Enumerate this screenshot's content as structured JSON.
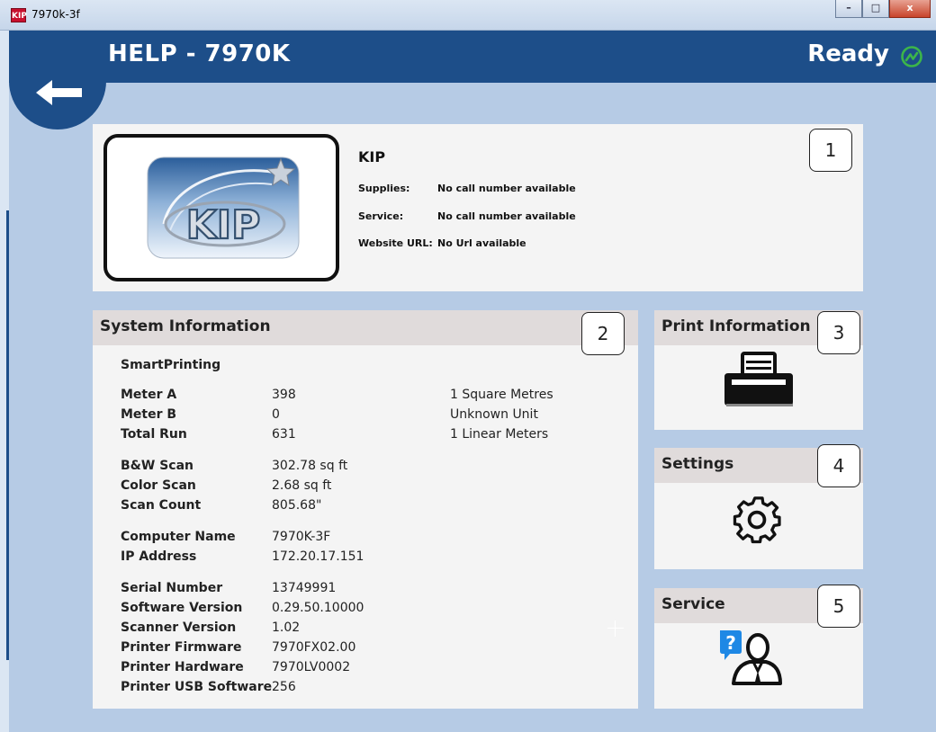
{
  "window": {
    "icon_text": "KIP",
    "title": "7970k-3f",
    "minimize": "–",
    "maximize": "□",
    "close": "x"
  },
  "header": {
    "title": "HELP - 7970K",
    "status": "Ready"
  },
  "contact": {
    "badge": "1",
    "brand": "KIP",
    "rows": [
      {
        "label": "Supplies:",
        "value": "No call number available"
      },
      {
        "label": "Service:",
        "value": "No call number available"
      },
      {
        "label": "Website URL:",
        "value": "No Url available"
      }
    ]
  },
  "system_info": {
    "title": "System Information",
    "badge": "2",
    "product": "SmartPrinting",
    "meters": [
      {
        "key": "Meter A",
        "value": "398",
        "unit": "1 Square Metres"
      },
      {
        "key": "Meter B",
        "value": "0",
        "unit": "Unknown Unit"
      },
      {
        "key": "Total Run",
        "value": "631",
        "unit": "1 Linear Meters"
      }
    ],
    "scan": [
      {
        "key": "B&W Scan",
        "value": "302.78 sq ft"
      },
      {
        "key": "Color Scan",
        "value": "2.68 sq ft"
      },
      {
        "key": "Scan Count",
        "value": "805.68\""
      }
    ],
    "network": [
      {
        "key": "Computer Name",
        "value": "7970K-3F"
      },
      {
        "key": "IP Address",
        "value": "172.20.17.151"
      }
    ],
    "versions": [
      {
        "key": "Serial Number",
        "value": "13749991"
      },
      {
        "key": "Software Version",
        "value": "0.29.50.10000"
      },
      {
        "key": "Scanner Version",
        "value": "1.02"
      },
      {
        "key": "Printer Firmware",
        "value": "7970FX02.00"
      },
      {
        "key": "Printer Hardware",
        "value": "7970LV0002"
      },
      {
        "key": "Printer USB Software",
        "value": "256"
      }
    ]
  },
  "side_panels": {
    "print": {
      "title": "Print Information",
      "badge": "3",
      "icon": "printer-icon"
    },
    "settings": {
      "title": "Settings",
      "badge": "4",
      "icon": "gear-icon"
    },
    "service": {
      "title": "Service",
      "badge": "5",
      "icon": "support-person-icon"
    }
  },
  "colors": {
    "header": "#1d4e89",
    "background": "#b6cbe5",
    "panel": "#f4f4f4",
    "panel_header": "#e0dbdb",
    "status_icon": "#3cb54a"
  }
}
